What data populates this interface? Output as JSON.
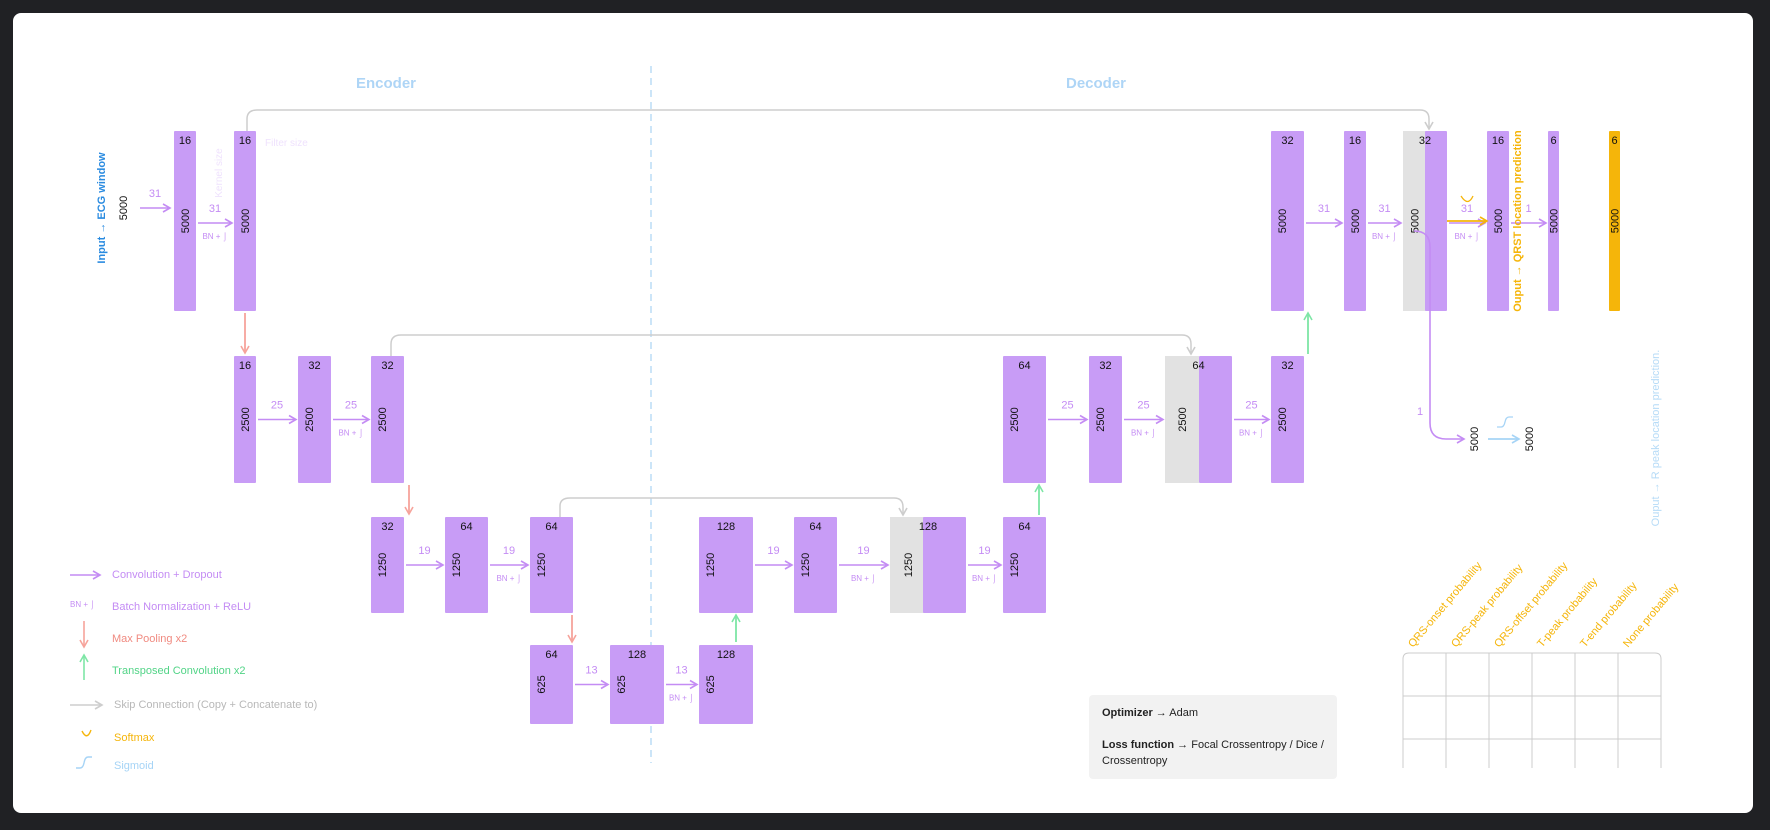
{
  "colors": {
    "block": "#c89cf6",
    "skip_block": "#e2e2e2",
    "conv_arrow": "#c48cf4",
    "pool_arrow": "#f6a39b",
    "upconv_arrow": "#7ee6a6",
    "skip_line": "#cdcdcd",
    "softmax": "#f5b50a",
    "sigmoid": "#a6d4f6",
    "section_title": "#aed5f6",
    "input_label": "#2a8be0",
    "output_qrst": "#f5b50a",
    "output_r": "#b6dbf7"
  },
  "sections": {
    "encoder": "Encoder",
    "decoder": "Decoder"
  },
  "input": {
    "label": "Input → ECG window",
    "size": "5000"
  },
  "annotations": {
    "filter_size": "Filter size",
    "kernel_size": "Kernel size",
    "bn_relu": "BN + ⌡"
  },
  "blocks": [
    {
      "filters": "16",
      "length": "5000"
    },
    {
      "filters": "16",
      "length": "5000"
    },
    {
      "filters": "16",
      "length": "2500"
    },
    {
      "filters": "32",
      "length": "2500"
    },
    {
      "filters": "32",
      "length": "2500"
    },
    {
      "filters": "32",
      "length": "1250"
    },
    {
      "filters": "64",
      "length": "1250"
    },
    {
      "filters": "64",
      "length": "1250"
    },
    {
      "filters": "64",
      "length": "625"
    },
    {
      "filters": "128",
      "length": "625"
    },
    {
      "filters": "128",
      "length": "625"
    },
    {
      "filters": "128",
      "length": "1250"
    },
    {
      "filters": "64",
      "length": "1250"
    },
    {
      "filters": "128",
      "length": "1250"
    },
    {
      "filters": "64",
      "length": "1250"
    },
    {
      "filters": "64",
      "length": "2500"
    },
    {
      "filters": "32",
      "length": "2500"
    },
    {
      "filters": "64",
      "length": "2500"
    },
    {
      "filters": "32",
      "length": "2500"
    },
    {
      "filters": "32",
      "length": "5000"
    },
    {
      "filters": "16",
      "length": "5000"
    },
    {
      "filters": "32",
      "length": "5000"
    },
    {
      "filters": "16",
      "length": "5000"
    },
    {
      "filters": "6",
      "length": "5000"
    },
    {
      "filters": "6",
      "length": "5000"
    }
  ],
  "kernels": [
    "31",
    "31",
    "25",
    "25",
    "19",
    "19",
    "13",
    "13",
    "19",
    "19",
    "19",
    "25",
    "25",
    "25",
    "31",
    "31",
    "31",
    "1",
    "1"
  ],
  "outputs": {
    "qrst": "Ouput → QRST location prediction",
    "r_peak": "Ouput → R peak location prediction.",
    "r_in": "5000",
    "r_out": "5000"
  },
  "legend": [
    {
      "name": "conv",
      "label": "Convolution + Dropout"
    },
    {
      "name": "bn",
      "label": "Batch Normalization + ReLU"
    },
    {
      "name": "pool",
      "label": "Max Pooling x2"
    },
    {
      "name": "upconv",
      "label": "Transposed Convolution x2"
    },
    {
      "name": "skip",
      "label": "Skip Connection (Copy + Concatenate to)"
    },
    {
      "name": "softmax",
      "label": "Softmax"
    },
    {
      "name": "sigmoid",
      "label": "Sigmoid"
    }
  ],
  "training": {
    "optimizer_key": "Optimizer",
    "optimizer_value": "→ Adam",
    "loss_key": "Loss function",
    "loss_value": "→ Focal Crossentropy / Dice / Crossentropy"
  },
  "output_table": {
    "columns": [
      "QRS-onset probability",
      "QRS-peak probability",
      "QRS-offset probability",
      "T-peak probability",
      "T-end probability",
      "None probability"
    ]
  }
}
